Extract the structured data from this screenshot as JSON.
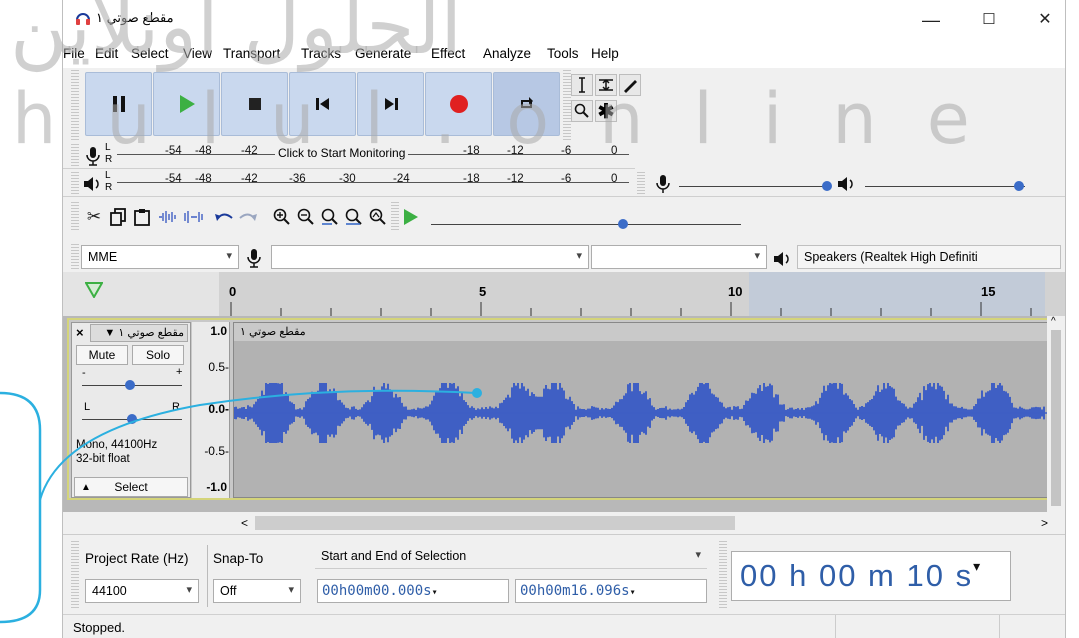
{
  "window": {
    "title": "مقطع صوتي ١",
    "controls": {
      "minimize": "—",
      "maximize": "☐",
      "close": "✕"
    }
  },
  "menu": [
    "File",
    "Edit",
    "Select",
    "View",
    "Transport",
    "Tracks",
    "Generate",
    "Effect",
    "Analyze",
    "Tools",
    "Help"
  ],
  "transport": {
    "pause": "pause-icon",
    "play": "play-icon",
    "stop": "stop-icon",
    "skip_start": "skip-start-icon",
    "skip_end": "skip-end-icon",
    "record": "record-icon",
    "loop": "loop-icon",
    "colors": {
      "button_bg": "#c9d8ee",
      "play": "#3cb043",
      "record": "#e02020"
    }
  },
  "tools": [
    "selection-tool-icon",
    "envelope-tool-icon",
    "draw-tool-icon",
    "zoom-tool-icon",
    "multi-tool-icon"
  ],
  "record_meter": {
    "ticks": [
      "-54",
      "-48",
      "-42",
      "-18",
      "-12",
      "-6",
      "0"
    ],
    "prompt": "Click to Start Monitoring",
    "channels": [
      "L",
      "R"
    ]
  },
  "playback_meter": {
    "ticks": [
      "-54",
      "-48",
      "-42",
      "-36",
      "-30",
      "-24",
      "-18",
      "-12",
      "-6",
      "0"
    ],
    "channels": [
      "L",
      "R"
    ]
  },
  "devices": {
    "host": "MME",
    "recording_device": "",
    "recording_channels": "",
    "playback_device": "Speakers (Realtek High Definiti"
  },
  "timeline": {
    "labels": [
      "0",
      "5",
      "10",
      "15"
    ]
  },
  "track": {
    "name": "مقطع صوتي ١",
    "close": "×",
    "mute": "Mute",
    "solo": "Solo",
    "gain_minus": "-",
    "gain_plus": "+",
    "pan_left": "L",
    "pan_right": "R",
    "format": "Mono, 44100Hz",
    "bit_depth": "32-bit float",
    "select": "Select",
    "clip_name": "مقطع صوتي ١",
    "y_ticks": [
      "1.0",
      "0.5-",
      "0.0-",
      "-0.5-",
      "-1.0"
    ],
    "waveform_color": "#3f5fc4"
  },
  "selection_bar": {
    "project_rate_label": "Project Rate (Hz)",
    "project_rate_value": "44100",
    "snap_to_label": "Snap-To",
    "snap_to_value": "Off",
    "selection_mode": "Start and End of Selection",
    "start_time": "00h00m00.000s",
    "end_time": "00h00m16.096s",
    "position": "00 h 00 m 10 s"
  },
  "status": "Stopped.",
  "watermark": {
    "arabic": "الحلول اونلاين",
    "latin": "hulul.online"
  }
}
